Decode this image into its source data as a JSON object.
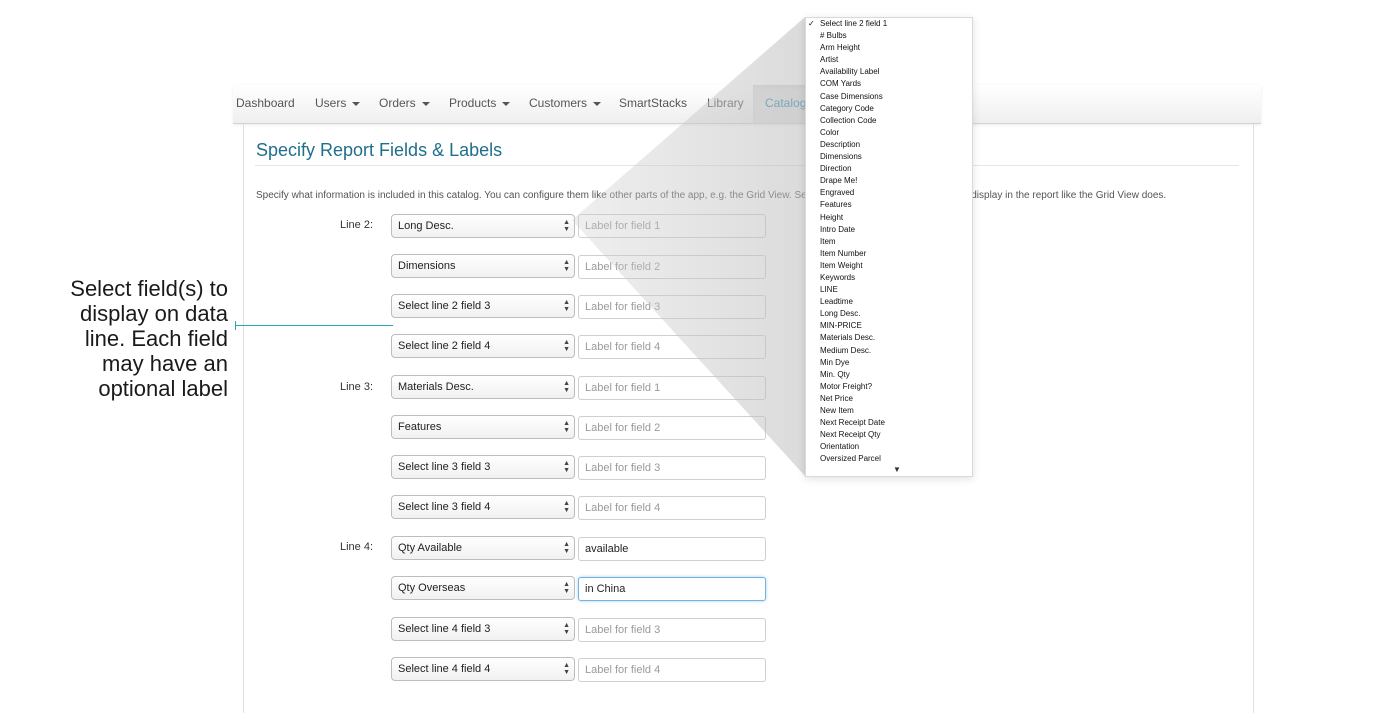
{
  "nav": {
    "items": [
      {
        "label": "Dashboard",
        "caret": false
      },
      {
        "label": "Users",
        "caret": true
      },
      {
        "label": "Orders",
        "caret": true
      },
      {
        "label": "Products",
        "caret": true
      },
      {
        "label": "Customers",
        "caret": true
      },
      {
        "label": "SmartStacks",
        "caret": false
      },
      {
        "label": "Library",
        "caret": false
      },
      {
        "label": "Catalogs",
        "caret": false,
        "active": true
      }
    ]
  },
  "page": {
    "title": "Specify Report Fields & Labels",
    "description": "Specify what information is included in this catalog. You can configure them like other parts of the app, e.g. the Grid View. Select field and optional label and it will display in the report like the Grid View does."
  },
  "lines": [
    {
      "label": "Line 2:",
      "fields": [
        {
          "select": "Long Desc.",
          "label_value": "",
          "placeholder": "Label for field 1"
        },
        {
          "select": "Dimensions",
          "label_value": "",
          "placeholder": "Label for field 2"
        },
        {
          "select": "Select line 2 field 3",
          "label_value": "",
          "placeholder": "Label for field 3"
        },
        {
          "select": "Select line 2 field 4",
          "label_value": "",
          "placeholder": "Label for field 4"
        }
      ]
    },
    {
      "label": "Line 3:",
      "fields": [
        {
          "select": "Materials Desc.",
          "label_value": "",
          "placeholder": "Label for field 1"
        },
        {
          "select": "Features",
          "label_value": "",
          "placeholder": "Label for field 2"
        },
        {
          "select": "Select line 3 field 3",
          "label_value": "",
          "placeholder": "Label for field 3"
        },
        {
          "select": "Select line 3 field 4",
          "label_value": "",
          "placeholder": "Label for field 4"
        }
      ]
    },
    {
      "label": "Line 4:",
      "fields": [
        {
          "select": "Qty Available",
          "label_value": "available",
          "placeholder": "Label for field 1"
        },
        {
          "select": "Qty Overseas",
          "label_value": "in China",
          "placeholder": "Label for field 2"
        },
        {
          "select": "Select line 4 field 3",
          "label_value": "",
          "placeholder": "Label for field 3"
        },
        {
          "select": "Select line 4 field 4",
          "label_value": "",
          "placeholder": "Label for field 4"
        }
      ]
    }
  ],
  "callout": {
    "text": "Select field(s) to display on data line. Each field may have an optional label"
  },
  "dropdown": {
    "selected": "Select line 2 field 1",
    "options": [
      "Select line 2 field 1",
      "# Bulbs",
      "Arm Height",
      "Artist",
      "Availability Label",
      "COM Yards",
      "Case Dimensions",
      "Category Code",
      "Collection Code",
      "Color",
      "Description",
      "Dimensions",
      "Direction",
      "Drape Me!",
      "Engraved",
      "Features",
      "Height",
      "Intro Date",
      "Item",
      "Item Number",
      "Item Weight",
      "Keywords",
      "LINE",
      "Leadtime",
      "Long Desc.",
      "MIN-PRICE",
      "Materials Desc.",
      "Medium Desc.",
      "Min Dye",
      "Min. Qty",
      "Motor Freight?",
      "Net Price",
      "New Item",
      "Next Receipt Date",
      "Next Receipt Qty",
      "Orientation",
      "Oversized Parcel"
    ],
    "scroll_glyph": "▼"
  },
  "colors": {
    "accent": "#2b8bb8",
    "title": "#1f6f8b",
    "callout_line": "#2aa5b8",
    "focus": "#6fb6e0"
  }
}
